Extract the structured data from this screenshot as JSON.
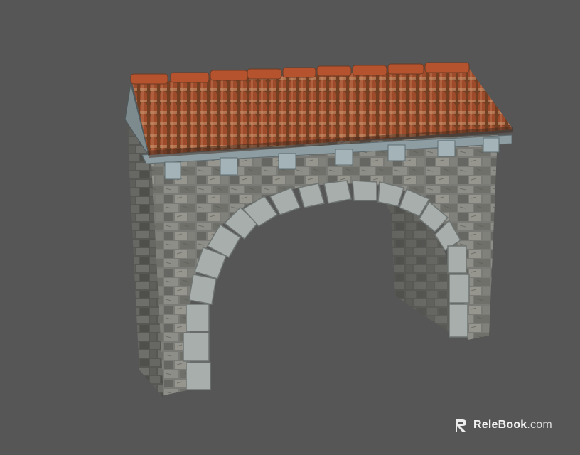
{
  "scene": {
    "subject": "stone-arch-gateway-with-tile-roof",
    "background_color": "#565656"
  },
  "colors": {
    "stone_light": "#9a9a94",
    "stone_mid": "#7f7f7a",
    "stone_dark": "#5c5c58",
    "arch_stone": "#a9b0ad",
    "roof_tile": "#a8502e",
    "roof_tile_dark": "#6b3a22",
    "roof_tile_light": "#c98a60",
    "cornice": "#8e9da2"
  },
  "watermark": {
    "brand": "ReleBook",
    "domain": ".com",
    "icon": "relebook-logo-icon"
  }
}
